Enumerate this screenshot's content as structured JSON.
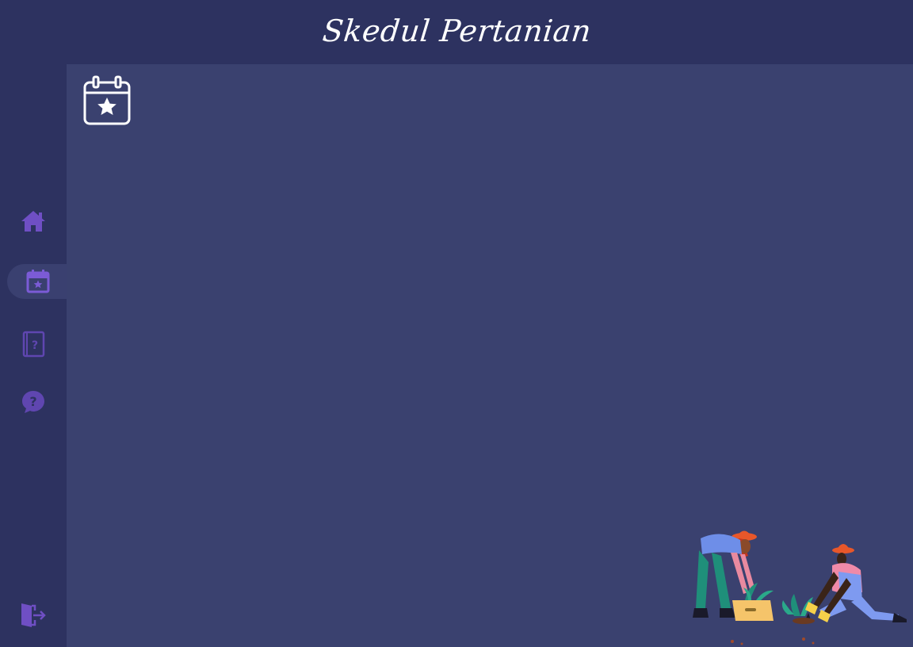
{
  "header": {
    "title": "Skedul Pertanian"
  },
  "sidebar": {
    "items": [
      {
        "id": "home",
        "icon": "home-icon",
        "active": false
      },
      {
        "id": "schedule",
        "icon": "calendar-star-icon",
        "active": true
      },
      {
        "id": "guide",
        "icon": "book-question-icon",
        "active": false
      },
      {
        "id": "help",
        "icon": "chat-question-icon",
        "active": false
      }
    ],
    "logout_icon": "logout-door-icon"
  },
  "main": {
    "page_icon": "calendar-star-icon",
    "illustration": "farmers-planting-illustration"
  },
  "colors": {
    "header_bg": "#2d3260",
    "sidebar_bg": "#2d3260",
    "main_bg": "#3a416f",
    "accent": "#7b5bd6",
    "title_text": "#ffffff"
  }
}
